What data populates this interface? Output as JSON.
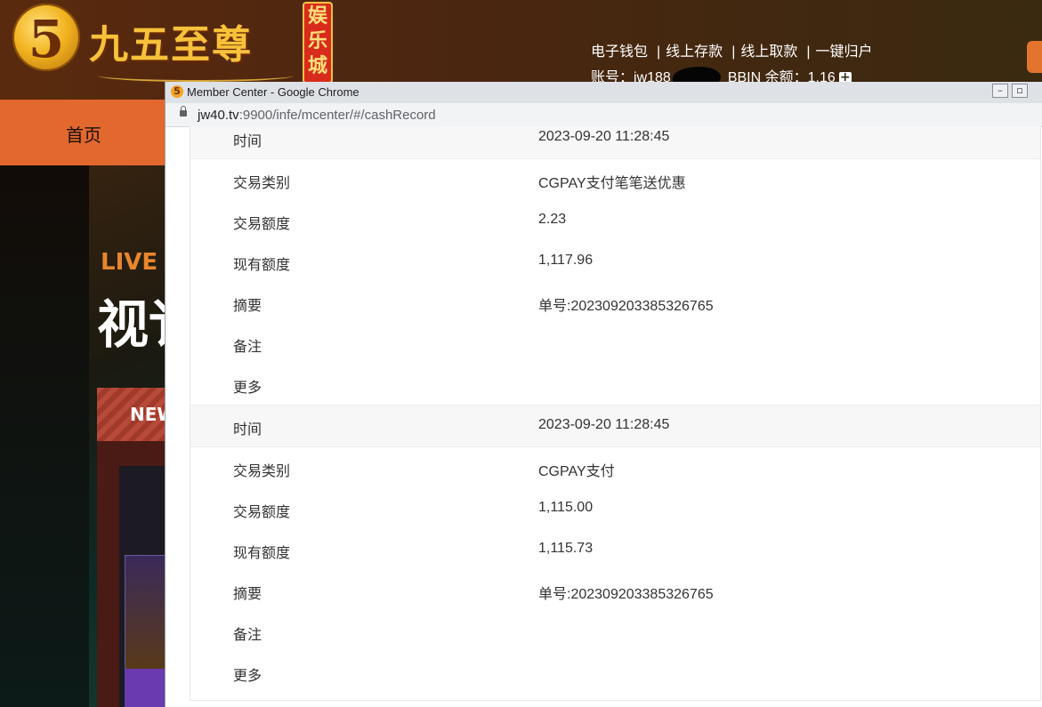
{
  "site": {
    "logo_coin_glyph": "5",
    "logo_title": "九五至尊",
    "logo_badge": "娱乐城",
    "top_links": [
      "电子钱包",
      "线上存款",
      "线上取款",
      "一键归户"
    ],
    "separator": "|",
    "account_label": "账号：",
    "account_prefix": "jw188",
    "balance_label": "BBIN 余额：",
    "balance_value": "1.16",
    "home_menu": "首页",
    "banner_live_text": "LIVE C",
    "banner_big_text": "视讠",
    "banner_new_text": "NEW"
  },
  "popup": {
    "window_title": "Member Center - Google Chrome",
    "url_host": "jw40.tv",
    "url_path": ":9900/infe/mcenter/#/cashRecord"
  },
  "records": [
    {
      "rows": [
        {
          "label": "时间",
          "value": "2023-09-20 11:28:45",
          "header": true
        },
        {
          "label": "交易类别",
          "value": "CGPAY支付笔笔送优惠"
        },
        {
          "label": "交易额度",
          "value": "2.23"
        },
        {
          "label": "现有额度",
          "value": "1,117.96"
        },
        {
          "label": "摘要",
          "value": "单号:202309203385326765"
        },
        {
          "label": "备注",
          "value": ""
        },
        {
          "label": "更多",
          "value": ""
        }
      ]
    },
    {
      "rows": [
        {
          "label": "时间",
          "value": "2023-09-20 11:28:45",
          "header": true
        },
        {
          "label": "交易类别",
          "value": "CGPAY支付"
        },
        {
          "label": "交易额度",
          "value": "1,115.00"
        },
        {
          "label": "现有额度",
          "value": "1,115.73"
        },
        {
          "label": "摘要",
          "value": "单号:202309203385326765"
        },
        {
          "label": "备注",
          "value": ""
        },
        {
          "label": "更多",
          "value": ""
        }
      ]
    }
  ]
}
